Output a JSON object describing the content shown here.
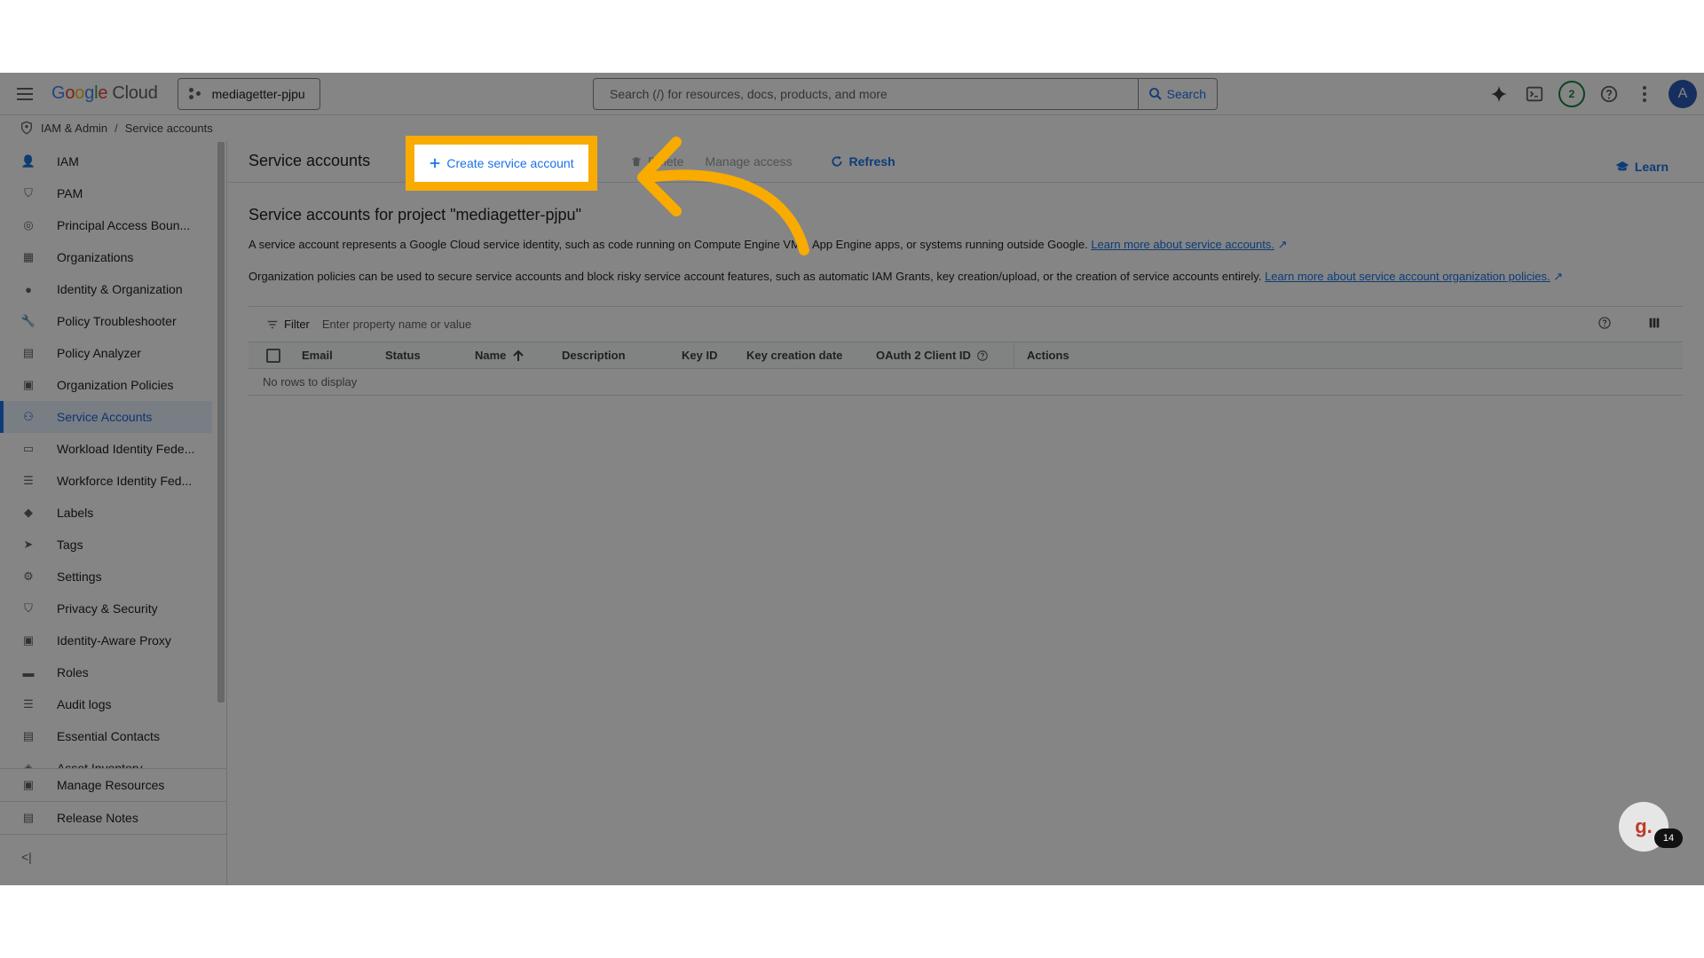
{
  "topbar": {
    "logo_google": "Google",
    "logo_cloud": "Cloud",
    "project": "mediagetter-pjpu",
    "search_placeholder": "Search (/) for resources, docs, products, and more",
    "search_button": "Search",
    "notification_count": "2",
    "avatar_letter": "A"
  },
  "breadcrumb": {
    "parent": "IAM & Admin",
    "separator": "/",
    "current": "Service accounts"
  },
  "sidebar": {
    "items": [
      {
        "label": "IAM",
        "icon": "person-add-icon"
      },
      {
        "label": "PAM",
        "icon": "shield-icon"
      },
      {
        "label": "Principal Access Boun...",
        "icon": "policy-icon"
      },
      {
        "label": "Organizations",
        "icon": "building-icon"
      },
      {
        "label": "Identity & Organization",
        "icon": "account-circle-icon"
      },
      {
        "label": "Policy Troubleshooter",
        "icon": "wrench-icon"
      },
      {
        "label": "Policy Analyzer",
        "icon": "document-search-icon"
      },
      {
        "label": "Organization Policies",
        "icon": "list-box-icon"
      },
      {
        "label": "Service Accounts",
        "icon": "service-account-icon"
      },
      {
        "label": "Workload Identity Fede...",
        "icon": "id-card-icon"
      },
      {
        "label": "Workforce Identity Fed...",
        "icon": "list-icon"
      },
      {
        "label": "Labels",
        "icon": "label-icon"
      },
      {
        "label": "Tags",
        "icon": "tag-icon"
      },
      {
        "label": "Settings",
        "icon": "gear-icon"
      },
      {
        "label": "Privacy & Security",
        "icon": "shield-lock-icon"
      },
      {
        "label": "Identity-Aware Proxy",
        "icon": "proxy-icon"
      },
      {
        "label": "Roles",
        "icon": "hat-icon"
      },
      {
        "label": "Audit logs",
        "icon": "lines-icon"
      },
      {
        "label": "Essential Contacts",
        "icon": "contact-icon"
      },
      {
        "label": "Asset Inventory",
        "icon": "diamond-icon"
      }
    ],
    "fixed": [
      {
        "label": "Manage Resources",
        "icon": "folder-icon"
      },
      {
        "label": "Release Notes",
        "icon": "notes-icon"
      }
    ],
    "collapse": "<|"
  },
  "main": {
    "title": "Service accounts",
    "create_button": "Create service account",
    "delete_button": "Delete",
    "manage_access_button": "Manage access",
    "refresh_button": "Refresh",
    "learn_button": "Learn",
    "heading": "Service accounts for project \"mediagetter-pjpu\"",
    "para1_text": "A service account represents a Google Cloud service identity, such as code running on Compute Engine VMs, App Engine apps, or systems running outside Google.",
    "para1_link": "Learn more about service accounts.",
    "para2_text": "Organization policies can be used to secure service accounts and block risky service account features, such as automatic IAM Grants, key creation/upload, or the creation of service accounts entirely.",
    "para2_link": "Learn more about service account organization policies.",
    "filter_label": "Filter",
    "filter_placeholder": "Enter property name or value",
    "columns": [
      "Email",
      "Status",
      "Name",
      "Description",
      "Key ID",
      "Key creation date",
      "OAuth 2 Client ID",
      "Actions"
    ],
    "empty_text": "No rows to display"
  },
  "chat": {
    "letter": "g.",
    "count": "14"
  },
  "colors": {
    "accent": "#1a73e8",
    "highlight": "#f9ab00"
  }
}
